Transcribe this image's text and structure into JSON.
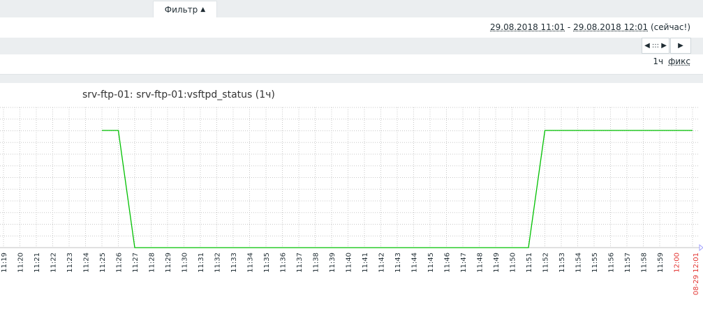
{
  "filter": {
    "label": "Фильтр",
    "arrow": "▲"
  },
  "timerange": {
    "from": "29.08.2018 11:01",
    "dash": " - ",
    "to": "29.08.2018 12:01",
    "now": " (сейчас!)"
  },
  "nav": {
    "scroll_label": "◀ ::: ▶",
    "next_label": "▶"
  },
  "period": {
    "value": "1ч",
    "fixed_label": "фикс"
  },
  "graph": {
    "title": "srv-ftp-01: srv-ftp-01:vsftpd_status (1ч)",
    "x_labels": [
      "11:19",
      "11:20",
      "11:21",
      "11:22",
      "11:23",
      "11:24",
      "11:25",
      "11:26",
      "11:27",
      "11:28",
      "11:29",
      "11:30",
      "11:31",
      "11:32",
      "11:33",
      "11:34",
      "11:35",
      "11:36",
      "11:37",
      "11:38",
      "11:39",
      "11:40",
      "11:41",
      "11:42",
      "11:43",
      "11:44",
      "11:45",
      "11:46",
      "11:47",
      "11:48",
      "11:49",
      "11:50",
      "11:51",
      "11:52",
      "11:53",
      "11:54",
      "11:55",
      "11:56",
      "11:57",
      "11:58",
      "11:59",
      "12:00"
    ],
    "end_label": "08-29 12:01",
    "highlight_label": "12:00",
    "line_color": "#00c000",
    "highlight_color": "#e33734",
    "data": [
      {
        "t": "11:25",
        "v": 1
      },
      {
        "t": "11:26",
        "v": 1
      },
      {
        "t": "11:27",
        "v": 0
      },
      {
        "t": "11:51",
        "v": 0
      },
      {
        "t": "11:52",
        "v": 1
      },
      {
        "t": "12:01",
        "v": 1
      }
    ]
  }
}
